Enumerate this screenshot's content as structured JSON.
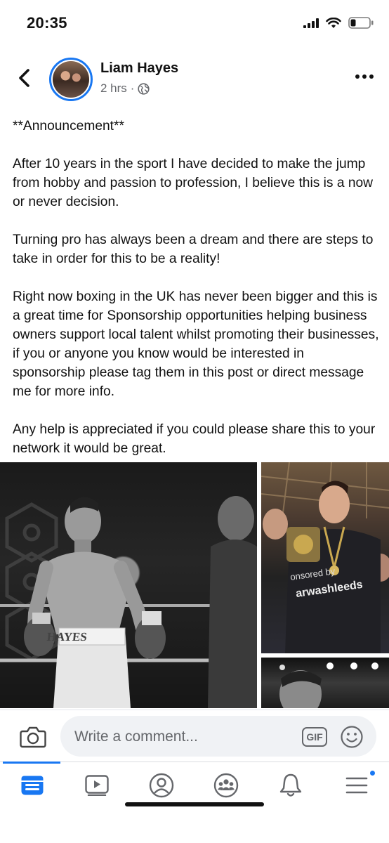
{
  "status_bar": {
    "time": "20:35",
    "icons": [
      "signal-icon",
      "wifi-icon",
      "battery-icon"
    ]
  },
  "post": {
    "author": "Liam Hayes",
    "time_ago": "2 hrs",
    "separator": "·",
    "privacy_icon": "globe-icon",
    "paragraphs": [
      "**Announcement**",
      "After 10 years in the sport I have decided to make the jump from hobby and passion to profession, I believe this is a now or never decision.",
      "Turning pro has always been a dream and there are steps to take in order for this to be a reality!",
      "Right now boxing in the UK has never been bigger and this is a great time for Sponsorship opportunities helping business owners support local talent whilst promoting their businesses, if you or anyone you know would be interested in sponsorship please tag them in this post or direct message me for more info.",
      "Any help is appreciated if you could please share this to your network it would be great."
    ],
    "photos": [
      {
        "trunks_text": "HAYES"
      },
      {
        "shirt_text_1": "onsored by",
        "shirt_text_2": "arwashleeds"
      },
      {}
    ]
  },
  "comment_bar": {
    "placeholder": "Write a comment...",
    "gif_label": "GIF"
  },
  "tab_bar": {
    "tabs": [
      {
        "name": "news-feed",
        "icon": "news-feed-icon",
        "active": true
      },
      {
        "name": "watch",
        "icon": "video-play-icon",
        "active": false
      },
      {
        "name": "profile",
        "icon": "profile-icon",
        "active": false
      },
      {
        "name": "groups",
        "icon": "groups-icon",
        "active": false
      },
      {
        "name": "notifications",
        "icon": "bell-icon",
        "active": false
      },
      {
        "name": "menu",
        "icon": "menu-icon",
        "active": false,
        "badge": true
      }
    ]
  },
  "colors": {
    "accent": "#1877f2",
    "secondary_text": "#65676b",
    "input_bg": "#f0f2f5"
  }
}
